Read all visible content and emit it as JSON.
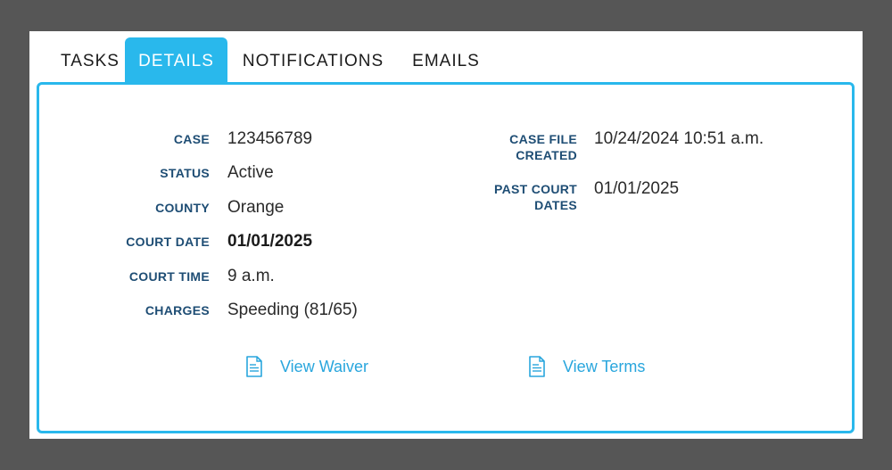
{
  "tabs": [
    {
      "label": "TASKS",
      "active": false
    },
    {
      "label": "DETAILS",
      "active": true
    },
    {
      "label": "NOTIFICATIONS",
      "active": false
    },
    {
      "label": "EMAILS",
      "active": false
    }
  ],
  "details": {
    "left": [
      {
        "label": "CASE",
        "value": "123456789"
      },
      {
        "label": "STATUS",
        "value": "Active"
      },
      {
        "label": "COUNTY",
        "value": "Orange"
      },
      {
        "label": "COURT DATE",
        "value": "01/01/2025"
      },
      {
        "label": "COURT TIME",
        "value": "9 a.m."
      },
      {
        "label": "CHARGES",
        "value": "Speeding (81/65)"
      }
    ],
    "right": [
      {
        "label_line1": "CASE FILE",
        "label_line2": "CREATED",
        "value": "10/24/2024 10:51 a.m."
      },
      {
        "label_line1": "PAST COURT",
        "label_line2": "DATES",
        "value": "01/01/2025"
      }
    ]
  },
  "links": {
    "waiver": "View Waiver",
    "terms": "View Terms"
  },
  "colors": {
    "accent": "#29b8ec",
    "label": "#1e4d74",
    "link": "#29a6dd",
    "background": "#565656"
  },
  "icons": {
    "waiver": "document-icon",
    "terms": "document-icon"
  }
}
